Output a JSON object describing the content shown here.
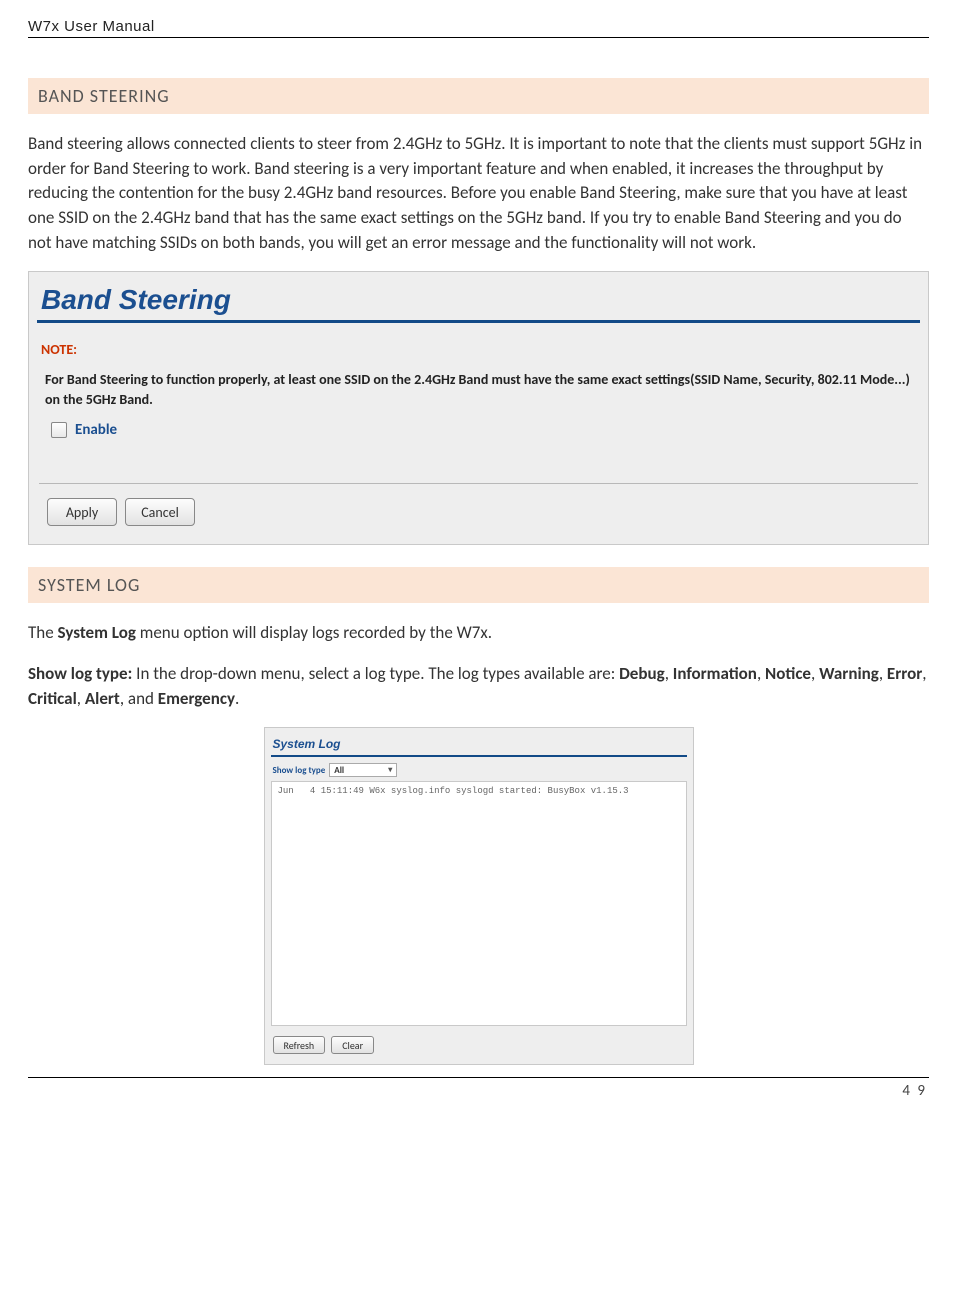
{
  "header": {
    "doc_title": "W7x  User Manual"
  },
  "band_steering": {
    "heading": "BAND STEERING",
    "paragraph": "Band steering allows connected clients to steer from 2.4GHz to 5GHz. It is important to note that the clients must support 5GHz in order for Band Steering to work. Band steering is a very important feature and when enabled, it increases the throughput by reducing the contention for the busy 2.4GHz band resources. Before you enable Band Steering, make sure that you have at least one SSID on the 2.4GHz band that has the same exact settings on the 5GHz band. If you try to enable Band Steering and you do not have matching SSIDs on both bands, you will get an error message and the functionality will not work.",
    "panel_title": "Band Steering",
    "note_label": "NOTE:",
    "note_text": "For Band Steering to function properly, at least one SSID on the 2.4GHz Band must have the same exact settings(SSID Name, Security, 802.11 Mode...) on the 5GHz Band.",
    "enable_label": "Enable",
    "apply_button": "Apply",
    "cancel_button": "Cancel"
  },
  "system_log": {
    "heading": "SYSTEM LOG",
    "intro_prefix": "The ",
    "intro_bold": "System Log",
    "intro_suffix": " menu option will display logs recorded by the W7x.",
    "show_bold": "Show log type:",
    "show_mid": " In the drop-down menu, select a log type. The log types available are: ",
    "types": [
      "Debug",
      "Information",
      "Notice",
      "Warning",
      "Error",
      "Critical",
      "Alert",
      "Emergency"
    ],
    "panel_title": "System Log",
    "show_label": "Show log type",
    "select_value": "All",
    "log_line": "Jun   4 15:11:49 W6x syslog.info syslogd started: BusyBox v1.15.3",
    "refresh_button": "Refresh",
    "clear_button": "Clear"
  },
  "footer": {
    "page_number": "4 9"
  }
}
